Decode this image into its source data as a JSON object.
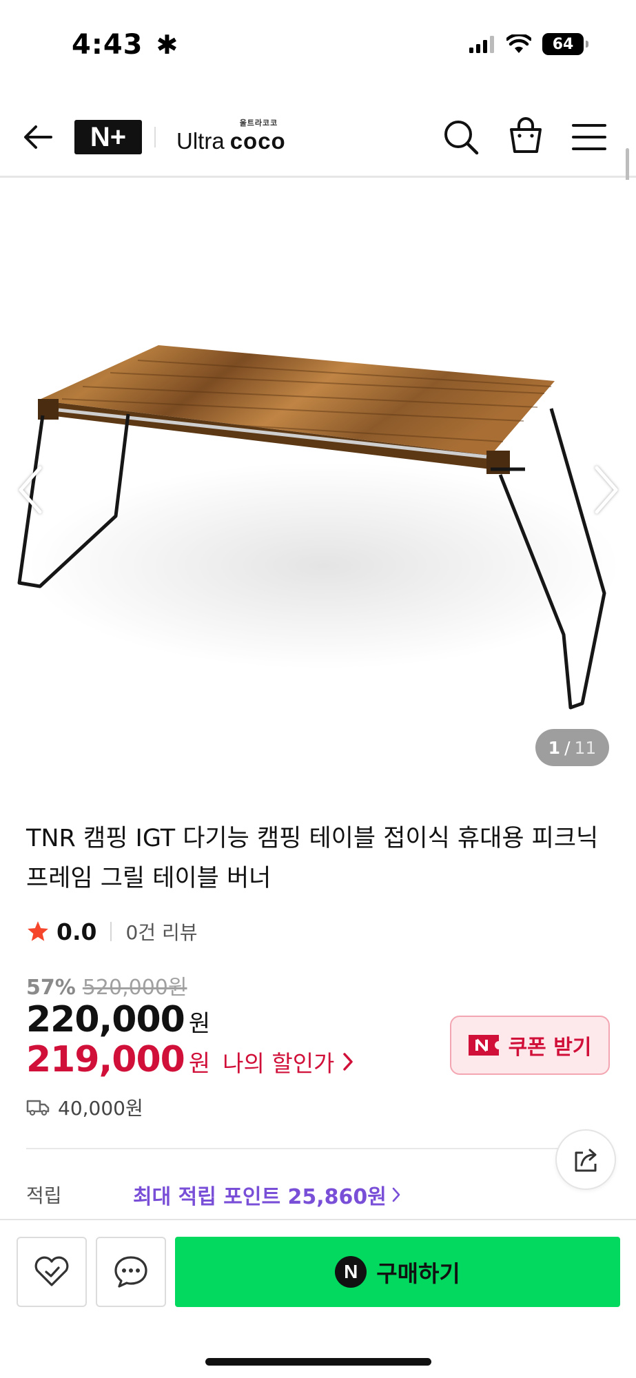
{
  "status_bar": {
    "time": "4:43",
    "battery": "64",
    "icons": [
      "asterisk-icon",
      "signal-icon",
      "wifi-icon",
      "battery-icon"
    ]
  },
  "header": {
    "brand_logo": "N+",
    "store_name_main": "Ultra",
    "store_name_accent": "coco",
    "store_name_korean": "울트라코코",
    "icons": [
      "back-arrow-icon",
      "search-icon",
      "shopping-bag-icon",
      "hamburger-menu-icon"
    ]
  },
  "gallery": {
    "current": "1",
    "separator": "/",
    "total": "11",
    "image_subject": "folding camping table with wooden top and black steel legs"
  },
  "product": {
    "title": "TNR 캠핑 IGT 다기능 캠핑 테이블 접이식 휴대용 피크닉 프레임 그릴 테이블 버너",
    "rating": "0.0",
    "review_count": "0건 리뷰",
    "discount_rate": "57%",
    "original_price": "520,000원",
    "sale_price": "220,000",
    "sale_unit": "원",
    "my_price": "219,000",
    "my_price_unit": "원",
    "my_price_link": "나의 할인가",
    "coupon_label": "쿠폰 받기",
    "shipping_fee": "40,000원",
    "points_label": "적립",
    "points_link": "최대 적립 포인트 25,860원"
  },
  "bottom_bar": {
    "buy_label": "구매하기",
    "buy_badge": "N"
  },
  "colors": {
    "accent_red": "#d1103a",
    "buy_green": "#03d85f",
    "points_purple": "#7a4fd8",
    "star": "#f5452a"
  }
}
